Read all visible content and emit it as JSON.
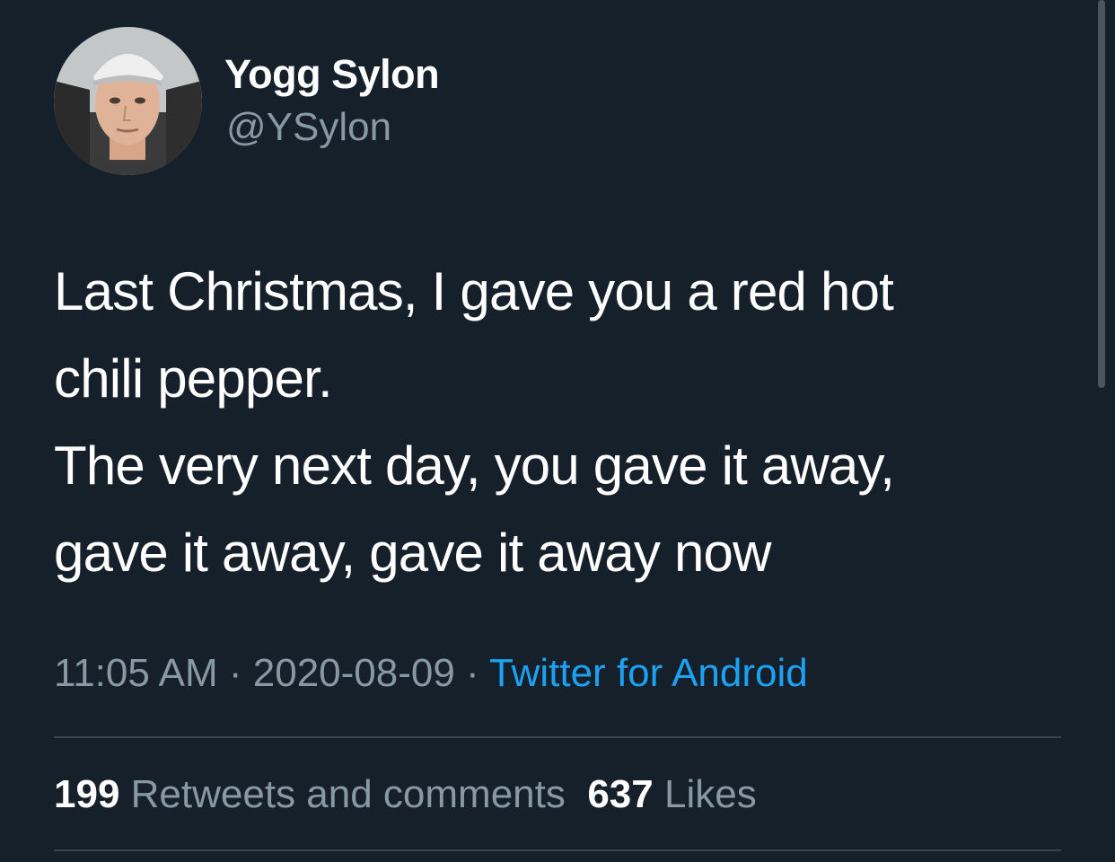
{
  "author": {
    "display_name": "Yogg Sylon",
    "handle": "@YSylon"
  },
  "tweet": {
    "lines": [
      "Last Christmas, I gave you a red hot",
      "chili pepper.",
      "The very next day, you gave it away,",
      "gave it away, gave it away now"
    ]
  },
  "meta": {
    "time": "11:05 AM",
    "separator": " · ",
    "date": "2020-08-09",
    "source": "Twitter for Android"
  },
  "stats": {
    "retweets_count": "199",
    "retweets_label": "Retweets and comments",
    "likes_count": "637",
    "likes_label": "Likes"
  },
  "colors": {
    "background": "#15202b",
    "primary_text": "#ffffff",
    "secondary_text": "#8899a6",
    "link": "#1da1f2",
    "divider": "#38444d"
  }
}
